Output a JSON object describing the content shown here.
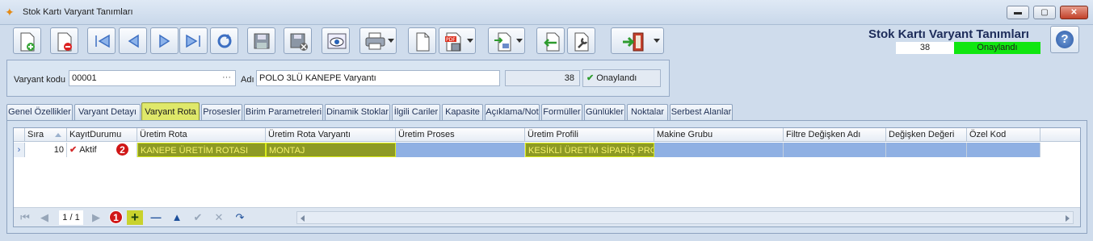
{
  "window": {
    "title": "Stok Kartı Varyant Tanımları",
    "controls": {
      "minimize": "▬",
      "maximize": "▢",
      "close": "✕"
    }
  },
  "toolbar": {
    "buttons": [
      "new-record-icon",
      "delete-record-icon",
      "first-record-icon",
      "previous-record-icon",
      "next-record-icon",
      "last-record-icon",
      "refresh-icon",
      "save-icon",
      "cancel-save-icon",
      "preview-icon",
      "print-icon",
      "document-icon",
      "pdf-export-icon",
      "export-icon",
      "import-icon",
      "tools-icon",
      "exit-icon"
    ]
  },
  "brand": {
    "title": "Stok Kartı Varyant Tanımları",
    "record_no": "38",
    "status": "Onaylandı",
    "status_color": "#10e610",
    "help_label": "?"
  },
  "header": {
    "variant_code_label": "Varyant kodu",
    "variant_code_value": "00001",
    "variant_code_dots": "···",
    "name_label": "Adı",
    "name_value": "POLO 3LÜ KANEPE Varyantı",
    "record_no": "38",
    "approval_check": "✔",
    "approval_label": "Onaylandı"
  },
  "tabs": [
    "Genel Özellikler",
    "Varyant Detayı",
    "Varyant Rota",
    "Prosesler",
    "Birim Parametreleri",
    "Dinamik Stoklar",
    "İlgili Cariler",
    "Kapasite",
    "Açıklama/Not",
    "Formüller",
    "Günlükler",
    "Noktalar",
    "Serbest Alanlar"
  ],
  "active_tab": "Varyant Rota",
  "grid": {
    "columns": [
      "Sıra",
      "KayıtDurumu",
      "Üretim Rota",
      "Üretim Rota Varyantı",
      "Üretim Proses",
      "Üretim Profili",
      "Makine Grubu",
      "Filtre Değişken Adı",
      "Değişken Değeri",
      "Özel Kod"
    ],
    "rows": [
      {
        "indicator": "›",
        "sira": "10",
        "status_check": "✔",
        "status": "Aktif",
        "rota": "KANEPE ÜRETİM ROTASI",
        "rota_variant": "MONTAJ",
        "proses": "",
        "profil": "KESİKLİ ÜRETİM SİPARİŞ PROFİ",
        "makine": "",
        "filtre": "",
        "deger": "",
        "ozel_kod": ""
      }
    ]
  },
  "badges": {
    "one": "1",
    "two": "2"
  },
  "navigator": {
    "first": "⏮",
    "prev": "◀",
    "page": "1 / 1",
    "next": "▶",
    "last": "⏭",
    "add": "+",
    "remove": "—",
    "up": "▲",
    "confirm": "✔",
    "cancel": "✕",
    "refresh": "↷"
  },
  "colors": {
    "active_tab": "#dfe86a",
    "highlight_cell": "#8d9a24",
    "selected_row": "#8fb0e3",
    "badge": "#d01616"
  }
}
